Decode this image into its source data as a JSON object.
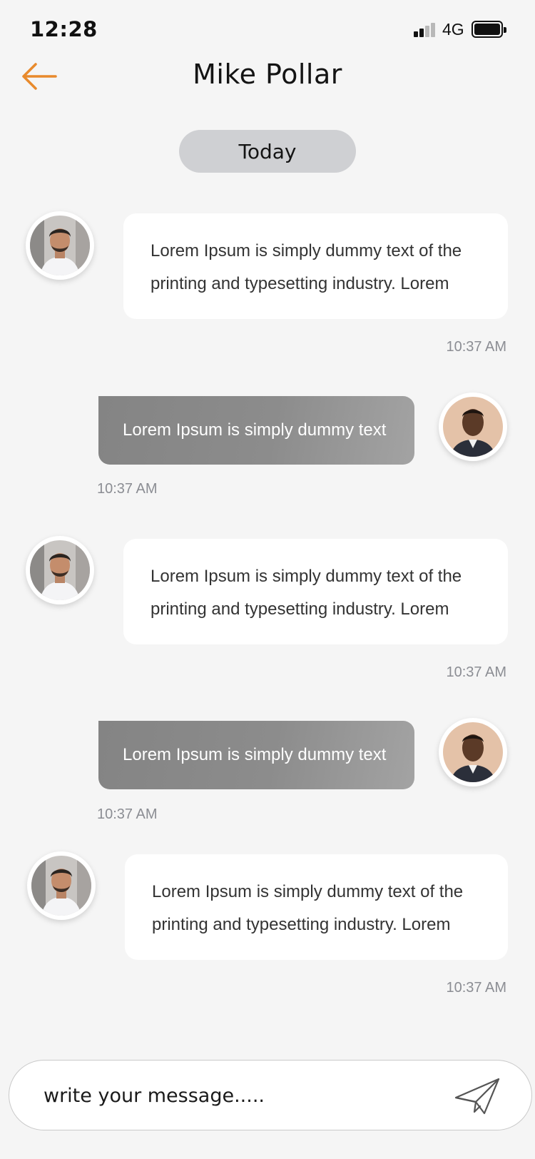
{
  "status_bar": {
    "time": "12:28",
    "network": "4G",
    "signal_bars_active": 2,
    "signal_bars_total": 4
  },
  "header": {
    "title": "Mike Pollar",
    "back_icon": "arrow-left-icon",
    "accent_color": "#e88a2c"
  },
  "date_separator": "Today",
  "messages": [
    {
      "direction": "incoming",
      "text_line1": "Lorem Ipsum is simply dummy text of the",
      "text_line2": "printing and typesetting industry. Lorem",
      "time": "10:37 AM"
    },
    {
      "direction": "outgoing",
      "text": "Lorem Ipsum is simply dummy text",
      "time": "10:37 AM"
    },
    {
      "direction": "incoming",
      "text_line1": "Lorem Ipsum is simply dummy text of the",
      "text_line2": "printing and typesetting industry. Lorem",
      "time": "10:37 AM"
    },
    {
      "direction": "outgoing",
      "text": "Lorem Ipsum is simply dummy text",
      "time": "10:37 AM"
    },
    {
      "direction": "incoming",
      "text_line1": "Lorem Ipsum is simply dummy text of the",
      "text_line2": "printing and typesetting industry. Lorem",
      "time": "10:37 AM"
    }
  ],
  "composer": {
    "placeholder": "write your message.....",
    "send_icon": "paper-plane-icon"
  }
}
